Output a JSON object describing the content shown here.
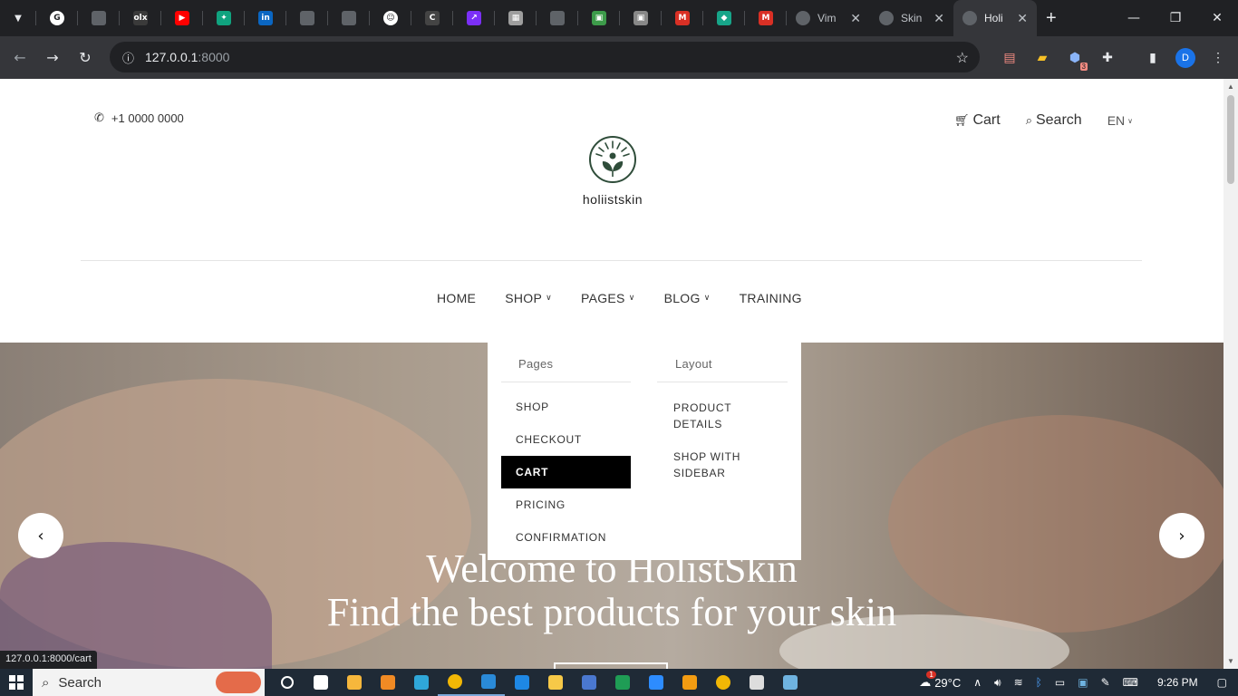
{
  "browser": {
    "tabs": [
      {
        "icon": "google-icon",
        "color": "#ffffff",
        "glyph": "G"
      },
      {
        "icon": "github-icon",
        "color": "#5f6368",
        "glyph": ""
      },
      {
        "icon": "olx-icon",
        "color": "#3a3a3a",
        "glyph": "olx"
      },
      {
        "icon": "youtube-icon",
        "color": "#ff0000",
        "glyph": "▶"
      },
      {
        "icon": "chatgpt-icon",
        "color": "#10a37f",
        "glyph": "✦"
      },
      {
        "icon": "linkedin-icon",
        "color": "#0a66c2",
        "glyph": "in"
      },
      {
        "icon": "github-icon",
        "color": "#5f6368",
        "glyph": ""
      },
      {
        "icon": "github-icon",
        "color": "#5f6368",
        "glyph": ""
      },
      {
        "icon": "smiley-icon",
        "color": "#ffffff",
        "glyph": "☺"
      },
      {
        "icon": "c-icon",
        "color": "#444444",
        "glyph": "C"
      },
      {
        "icon": "arrow-app-icon",
        "color": "#7b2ff7",
        "glyph": "↗"
      },
      {
        "icon": "trello-icon",
        "color": "#9e9e9e",
        "glyph": "▦"
      },
      {
        "icon": "github-icon",
        "color": "#5f6368",
        "glyph": ""
      },
      {
        "icon": "image-icon",
        "color": "#3d9b4a",
        "glyph": "▣"
      },
      {
        "icon": "image-icon",
        "color": "#888888",
        "glyph": "▣"
      },
      {
        "icon": "gmail-icon",
        "color": "#d93025",
        "glyph": "M"
      },
      {
        "icon": "diamond-icon",
        "color": "#17a589",
        "glyph": "◆"
      },
      {
        "icon": "gmail-icon",
        "color": "#d93025",
        "glyph": "M"
      }
    ],
    "named_tabs": [
      {
        "title": "Vim",
        "active": false
      },
      {
        "title": "Skin",
        "active": false
      },
      {
        "title": "Holi",
        "active": true
      }
    ],
    "url_host": "127.0.0.1",
    "url_port": ":8000",
    "status_url": "127.0.0.1:8000/cart",
    "profile_initial": "D",
    "extension_badge": "3"
  },
  "site": {
    "phone": "+1 0000 0000",
    "cart_label": "Cart",
    "search_label": "Search",
    "lang": "EN",
    "logo_text": "holiistskin",
    "nav": [
      {
        "label": "HOME",
        "caret": false
      },
      {
        "label": "SHOP",
        "caret": true
      },
      {
        "label": "PAGES",
        "caret": true
      },
      {
        "label": "BLOG",
        "caret": true
      },
      {
        "label": "TRAINING",
        "caret": false
      }
    ],
    "dropdown": {
      "pages_heading": "Pages",
      "layout_heading": "Layout",
      "pages_items": [
        "SHOP",
        "CHECKOUT",
        "CART",
        "PRICING",
        "CONFIRMATION"
      ],
      "active_item": "CART",
      "layout_items": [
        [
          "PRODUCT",
          "DETAILS"
        ],
        [
          "SHOP WITH",
          "SIDEBAR"
        ]
      ]
    },
    "hero": {
      "line1": "Welcome to HolistSkin",
      "line2": "Find the best products for your skin"
    }
  },
  "taskbar": {
    "search_label": "Search",
    "temperature": "29°C",
    "weather_badge": "1",
    "time": "9:26 PM",
    "apps": [
      {
        "icon": "cortana-icon",
        "color": "#ffffff"
      },
      {
        "icon": "task-view-icon",
        "color": "#ffffff"
      },
      {
        "icon": "store-icon",
        "color": "#f6b73c"
      },
      {
        "icon": "vlc-icon",
        "color": "#f08a24"
      },
      {
        "icon": "edge-icon",
        "color": "#2fa7d9"
      },
      {
        "icon": "chrome-icon",
        "color": "#f2b705"
      },
      {
        "icon": "vscode-icon",
        "color": "#2a8ad8"
      },
      {
        "icon": "play-icon",
        "color": "#1e88e5"
      },
      {
        "icon": "folder-icon",
        "color": "#f7c948"
      },
      {
        "icon": "app-icon",
        "color": "#4a78d0"
      },
      {
        "icon": "excel-icon",
        "color": "#1f9d55"
      },
      {
        "icon": "zoom-icon",
        "color": "#2d8cff"
      },
      {
        "icon": "media-icon",
        "color": "#f39c12"
      },
      {
        "icon": "chrome-icon",
        "color": "#f2b705"
      },
      {
        "icon": "tools-icon",
        "color": "#dddddd"
      },
      {
        "icon": "keyboard-icon",
        "color": "#6fb3e0"
      }
    ]
  }
}
